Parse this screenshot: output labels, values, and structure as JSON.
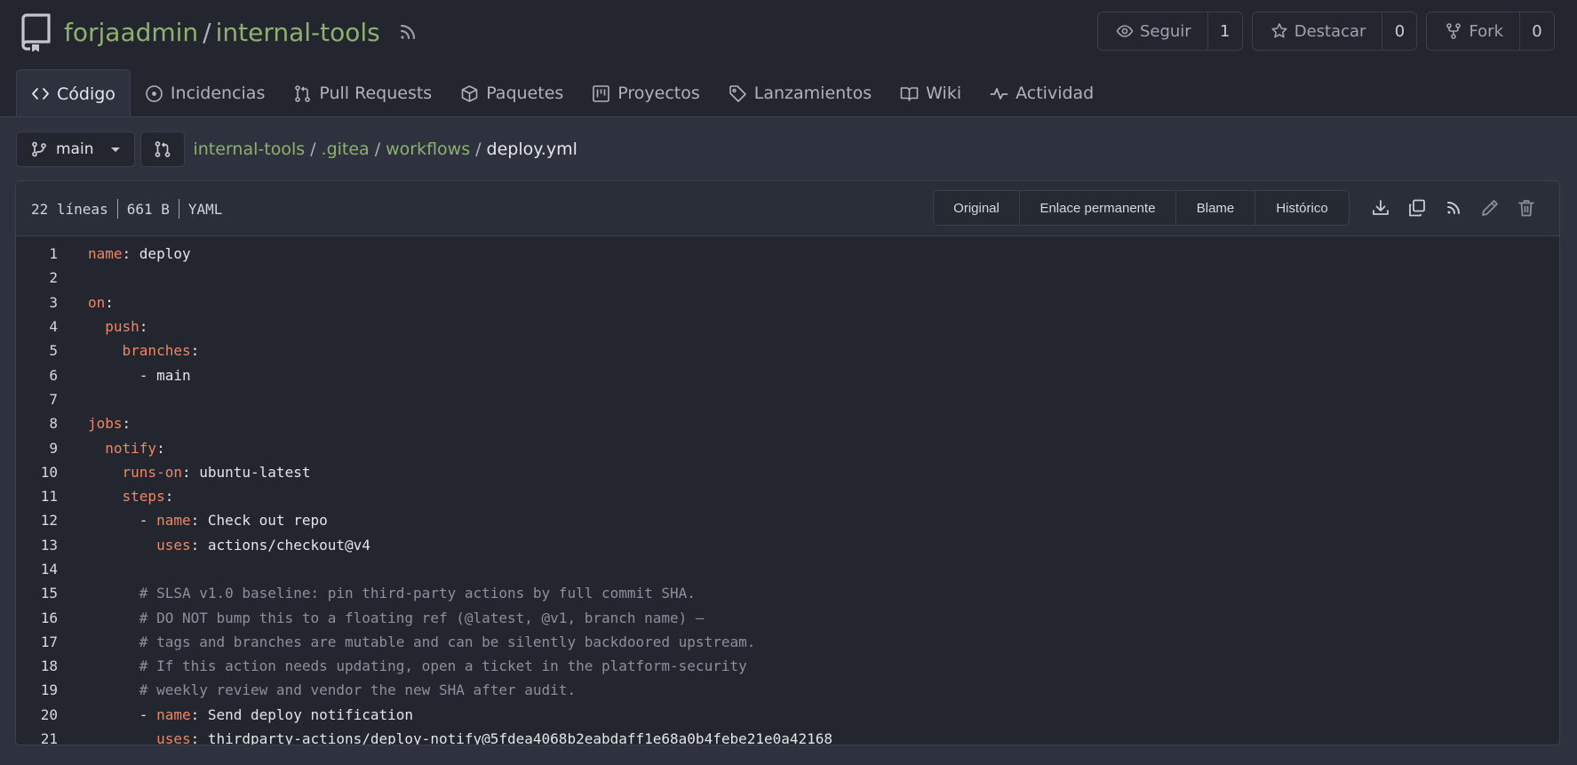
{
  "repo": {
    "owner": "forjaadmin",
    "name": "internal-tools",
    "actions": [
      {
        "label": "Seguir",
        "count": "1",
        "icon": "eye-icon"
      },
      {
        "label": "Destacar",
        "count": "0",
        "icon": "star-icon"
      },
      {
        "label": "Fork",
        "count": "0",
        "icon": "fork-icon"
      }
    ]
  },
  "tabs": [
    {
      "label": "Código",
      "icon": "code-icon",
      "active": true
    },
    {
      "label": "Incidencias",
      "icon": "issue-icon"
    },
    {
      "label": "Pull Requests",
      "icon": "pull-request-icon"
    },
    {
      "label": "Paquetes",
      "icon": "package-icon"
    },
    {
      "label": "Proyectos",
      "icon": "project-icon"
    },
    {
      "label": "Lanzamientos",
      "icon": "tag-icon"
    },
    {
      "label": "Wiki",
      "icon": "book-icon"
    },
    {
      "label": "Actividad",
      "icon": "pulse-icon"
    }
  ],
  "branch": "main",
  "breadcrumb": {
    "items": [
      "internal-tools",
      ".gitea",
      "workflows"
    ],
    "current": "deploy.yml"
  },
  "file": {
    "lines": "22 líneas",
    "size": "661 B",
    "language": "YAML",
    "buttons": [
      "Original",
      "Enlace permanente",
      "Blame",
      "Histórico"
    ],
    "icons": [
      "download-icon",
      "copy-icon",
      "rss-icon",
      "edit-icon",
      "trash-icon"
    ]
  },
  "code_lines": [
    [
      {
        "t": "k",
        "s": "name"
      },
      {
        "t": "p",
        "s": ": deploy"
      }
    ],
    [],
    [
      {
        "t": "k",
        "s": "on"
      },
      {
        "t": "p",
        "s": ":"
      }
    ],
    [
      {
        "t": "p",
        "s": "  "
      },
      {
        "t": "k",
        "s": "push"
      },
      {
        "t": "p",
        "s": ":"
      }
    ],
    [
      {
        "t": "p",
        "s": "    "
      },
      {
        "t": "k",
        "s": "branches"
      },
      {
        "t": "p",
        "s": ":"
      }
    ],
    [
      {
        "t": "p",
        "s": "      - main"
      }
    ],
    [],
    [
      {
        "t": "k",
        "s": "jobs"
      },
      {
        "t": "p",
        "s": ":"
      }
    ],
    [
      {
        "t": "p",
        "s": "  "
      },
      {
        "t": "k",
        "s": "notify"
      },
      {
        "t": "p",
        "s": ":"
      }
    ],
    [
      {
        "t": "p",
        "s": "    "
      },
      {
        "t": "k",
        "s": "runs-on"
      },
      {
        "t": "p",
        "s": ": ubuntu-latest"
      }
    ],
    [
      {
        "t": "p",
        "s": "    "
      },
      {
        "t": "k",
        "s": "steps"
      },
      {
        "t": "p",
        "s": ":"
      }
    ],
    [
      {
        "t": "p",
        "s": "      - "
      },
      {
        "t": "k",
        "s": "name"
      },
      {
        "t": "p",
        "s": ": Check out repo"
      }
    ],
    [
      {
        "t": "p",
        "s": "        "
      },
      {
        "t": "k",
        "s": "uses"
      },
      {
        "t": "p",
        "s": ": actions/checkout@v4"
      }
    ],
    [],
    [
      {
        "t": "c",
        "s": "      # SLSA v1.0 baseline: pin third-party actions by full commit SHA."
      }
    ],
    [
      {
        "t": "c",
        "s": "      # DO NOT bump this to a floating ref (@latest, @v1, branch name) —"
      }
    ],
    [
      {
        "t": "c",
        "s": "      # tags and branches are mutable and can be silently backdoored upstream."
      }
    ],
    [
      {
        "t": "c",
        "s": "      # If this action needs updating, open a ticket in the platform-security"
      }
    ],
    [
      {
        "t": "c",
        "s": "      # weekly review and vendor the new SHA after audit."
      }
    ],
    [
      {
        "t": "p",
        "s": "      - "
      },
      {
        "t": "k",
        "s": "name"
      },
      {
        "t": "p",
        "s": ": Send deploy notification"
      }
    ],
    [
      {
        "t": "p",
        "s": "        "
      },
      {
        "t": "k",
        "s": "uses"
      },
      {
        "t": "p",
        "s": ": thirdparty-actions/deploy-notify@5fdea4068b2eabdaff1e68a0b4febe21e0a42168"
      }
    ]
  ]
}
